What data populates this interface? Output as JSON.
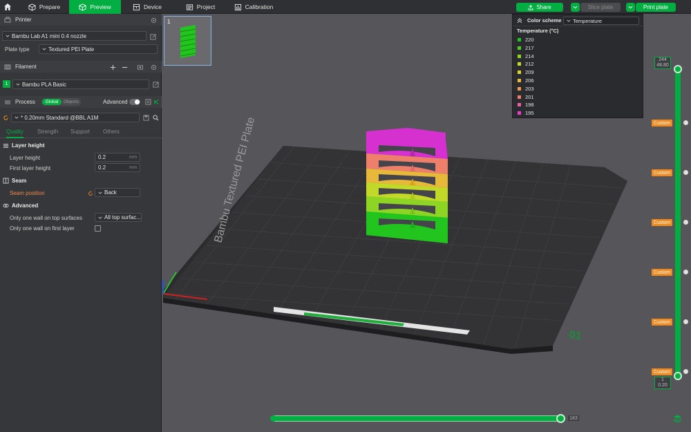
{
  "topbar": {
    "tabs": [
      {
        "label": "Prepare",
        "icon": "cube-icon"
      },
      {
        "label": "Preview",
        "icon": "cube-icon",
        "active": true
      },
      {
        "label": "Device",
        "icon": "device-icon"
      },
      {
        "label": "Project",
        "icon": "project-icon"
      },
      {
        "label": "Calibration",
        "icon": "calibration-icon"
      }
    ],
    "share_label": "Share",
    "slice_label": "Slice plate",
    "print_label": "Print plate"
  },
  "sidebar": {
    "printer": {
      "header": "Printer",
      "printer_name": "Bambu Lab A1 mini 0.4 nozzle",
      "plate_type_label": "Plate type",
      "plate_type_value": "Textured PEI Plate"
    },
    "filament": {
      "header": "Filament",
      "slot_number": "1",
      "filament_name": "Bambu PLA Basic"
    },
    "process": {
      "header": "Process",
      "toggle_global": "Global",
      "toggle_objects": "Objects",
      "advanced_label": "Advanced",
      "profile": "* 0.20mm Standard @BBL A1M",
      "tabs": [
        "Quality",
        "Strength",
        "Support",
        "Others"
      ]
    },
    "layer_height": {
      "title": "Layer height",
      "layer_height_label": "Layer height",
      "layer_height_value": "0.2",
      "first_layer_label": "First layer height",
      "first_layer_value": "0.2",
      "unit": "mm"
    },
    "seam": {
      "title": "Seam",
      "seam_position_label": "Seam position",
      "seam_position_value": "Back"
    },
    "advanced": {
      "title": "Advanced",
      "one_wall_top_label": "Only one wall on top surfaces",
      "one_wall_top_value": "All top surfac...",
      "one_wall_first_label": "Only one wall on first layer"
    }
  },
  "thumbnail": {
    "plate_number": "1"
  },
  "legend": {
    "scheme_label": "Color scheme",
    "scheme_value": "Temperature",
    "title": "Temperature (°C)",
    "items": [
      {
        "value": "220",
        "color": "#22c51e"
      },
      {
        "value": "217",
        "color": "#4ccf22"
      },
      {
        "value": "214",
        "color": "#8ed424"
      },
      {
        "value": "212",
        "color": "#c3d92a"
      },
      {
        "value": "209",
        "color": "#e0d22c"
      },
      {
        "value": "206",
        "color": "#e8b83a"
      },
      {
        "value": "203",
        "color": "#ec9a52"
      },
      {
        "value": "201",
        "color": "#ee7f6a"
      },
      {
        "value": "198",
        "color": "#ef5fa0"
      },
      {
        "value": "195",
        "color": "#ec3fd0"
      }
    ]
  },
  "plate": {
    "label": "Bambu Textured PEI Plate",
    "number": "01"
  },
  "layer_slider": {
    "top_layer": "244",
    "top_height": "48.80",
    "bottom_layer": "1",
    "bottom_height": "0.20",
    "custom_label": "Custom"
  },
  "move_slider": {
    "value": "183"
  }
}
